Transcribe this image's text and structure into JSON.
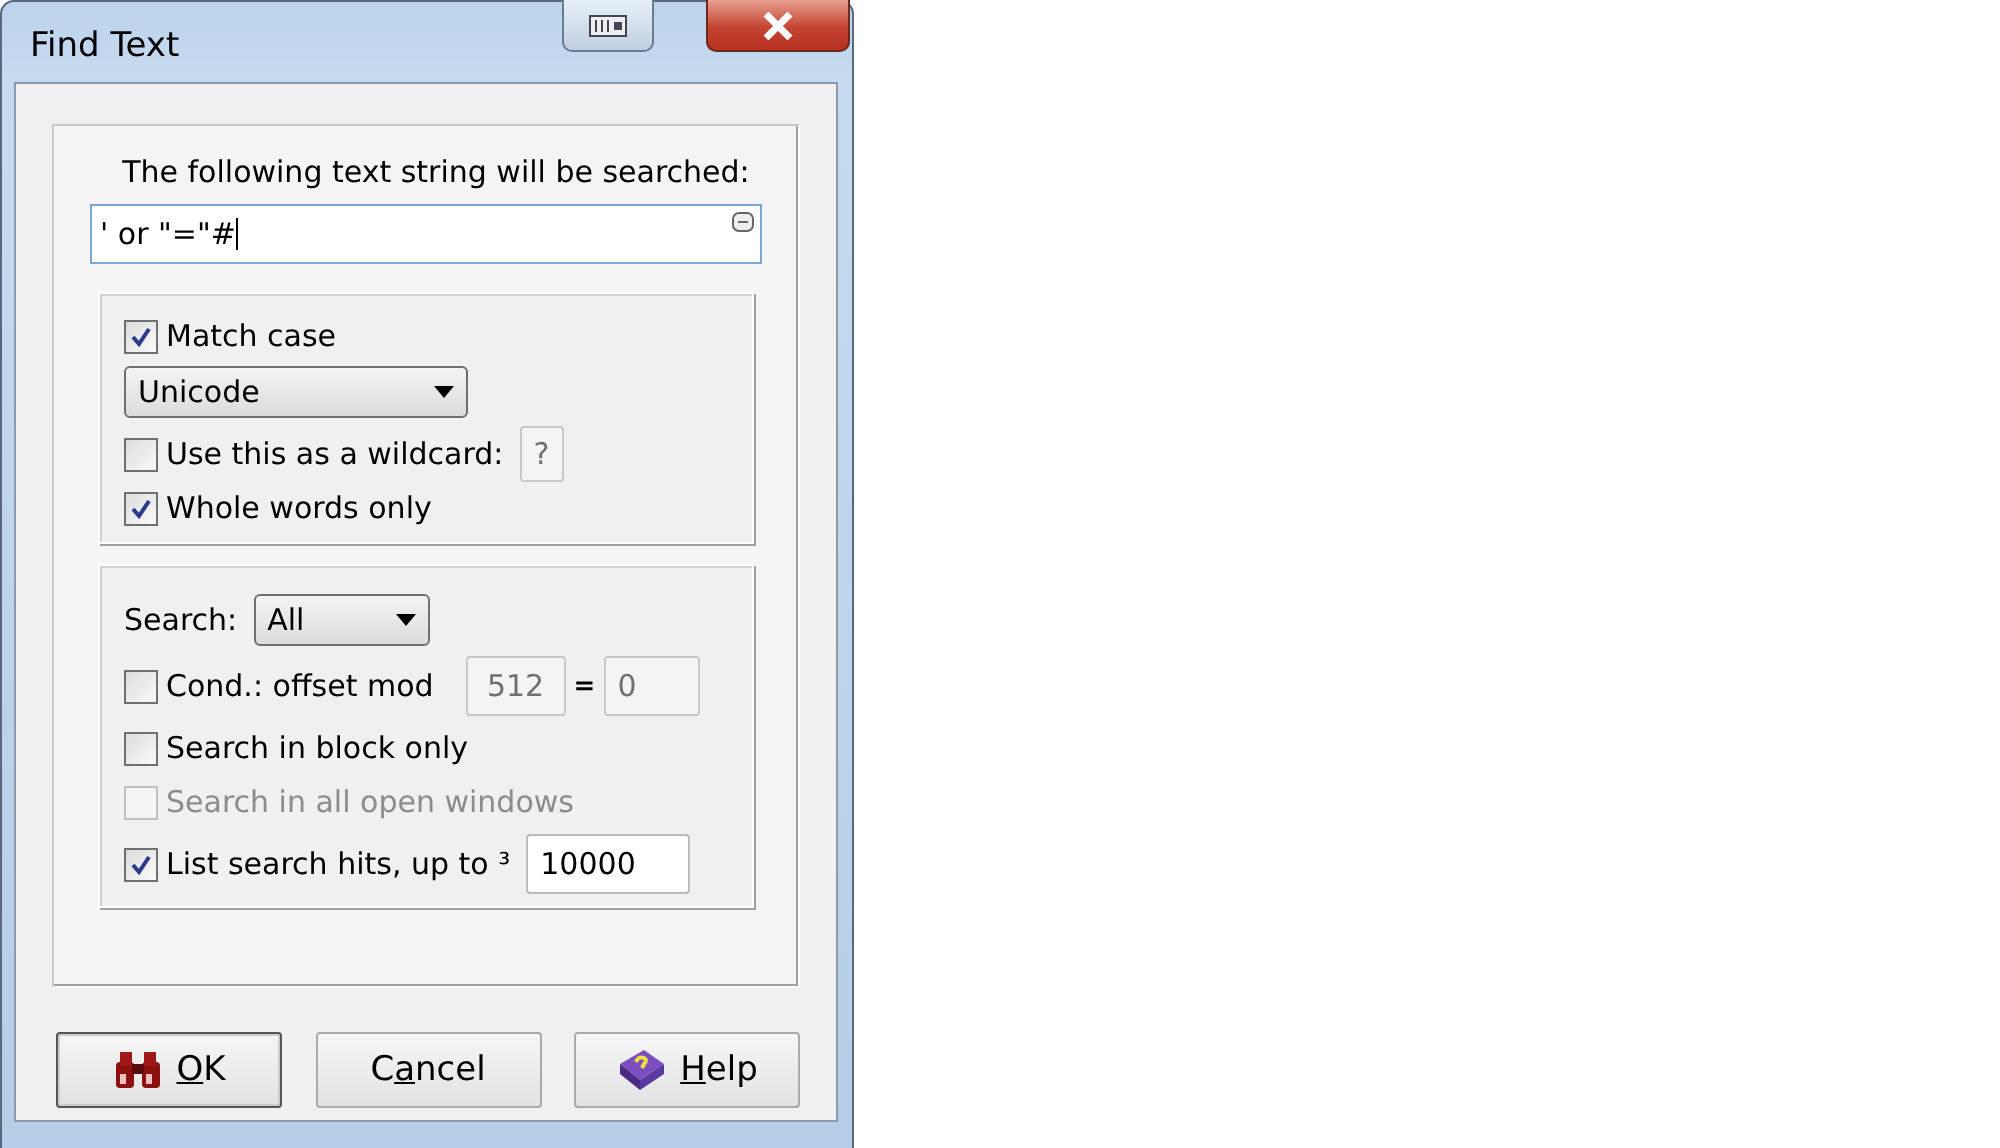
{
  "window": {
    "title": "Find Text"
  },
  "search_text": {
    "label": "The following text string will be searched:",
    "value": "' or \"=\"#"
  },
  "options": [
    {
      "kind": "checkbox",
      "label": "Match case",
      "checked": true,
      "disabled": false
    },
    {
      "kind": "dropdown",
      "value": "Unicode"
    },
    {
      "kind": "checkbox_field",
      "label": "Use this as a wildcard:",
      "checked": false,
      "disabled": false,
      "field": "?"
    },
    {
      "kind": "checkbox",
      "label": "Whole words only",
      "checked": true,
      "disabled": false
    }
  ],
  "search_options": [
    {
      "kind": "dropdown",
      "label": "Search:",
      "value": "All"
    },
    {
      "kind": "checkbox_mod",
      "label": "Cond.: offset mod",
      "checked": false,
      "disabled": false,
      "field": "512",
      "equals": "=",
      "field2": "0"
    },
    {
      "kind": "checkbox",
      "label": "Search in block only",
      "checked": false,
      "disabled": false
    },
    {
      "kind": "checkbox",
      "label": "Search in all open windows",
      "checked": false,
      "disabled": true
    },
    {
      "kind": "checkbox_value",
      "label": "List search hits, up to ³",
      "checked": true,
      "disabled": false,
      "value": "10000"
    }
  ],
  "buttons": [
    {
      "kind": "ok",
      "key": "O",
      "after": "K",
      "default": true
    },
    {
      "kind": "cancel",
      "before": "C",
      "key": "a",
      "after": "ncel",
      "default": false
    },
    {
      "kind": "help",
      "key": "H",
      "after": "elp",
      "default": false
    }
  ]
}
